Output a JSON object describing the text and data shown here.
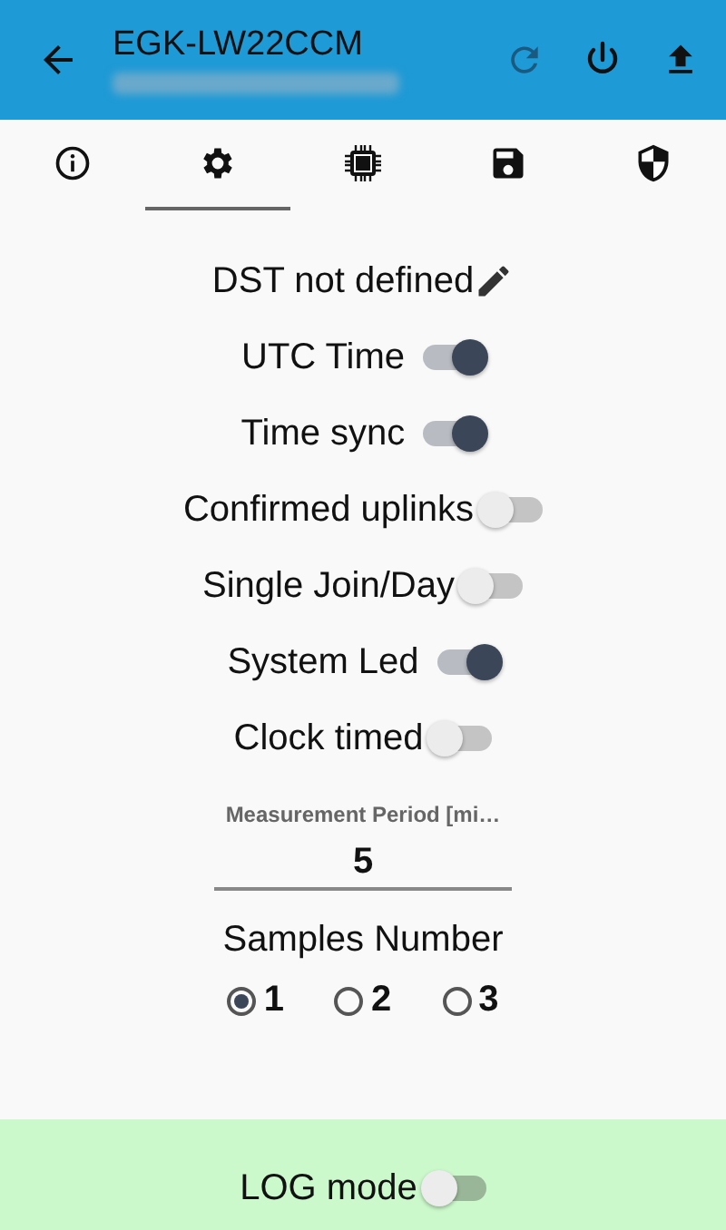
{
  "header": {
    "title": "EGK-LW22CCM"
  },
  "tabs": [
    {
      "kind": "info",
      "selected": false
    },
    {
      "kind": "settings",
      "selected": true
    },
    {
      "kind": "chip",
      "selected": false
    },
    {
      "kind": "save",
      "selected": false
    },
    {
      "kind": "security",
      "selected": false
    }
  ],
  "dst": {
    "label": "DST not defined"
  },
  "switches": [
    {
      "label": "UTC Time",
      "on": true
    },
    {
      "label": "Time sync",
      "on": true
    },
    {
      "label": "Confirmed uplinks",
      "on": false
    },
    {
      "label": "Single Join/Day",
      "on": false
    },
    {
      "label": "System Led",
      "on": true
    },
    {
      "label": "Clock timed",
      "on": false
    }
  ],
  "measurement_period": {
    "label": "Measurement Period [mi…",
    "value": "5"
  },
  "samples": {
    "label": "Samples Number",
    "options": [
      {
        "label": "1",
        "selected": true
      },
      {
        "label": "2",
        "selected": false
      },
      {
        "label": "3",
        "selected": false
      }
    ]
  },
  "log_mode": {
    "label": "LOG mode",
    "on": false
  }
}
